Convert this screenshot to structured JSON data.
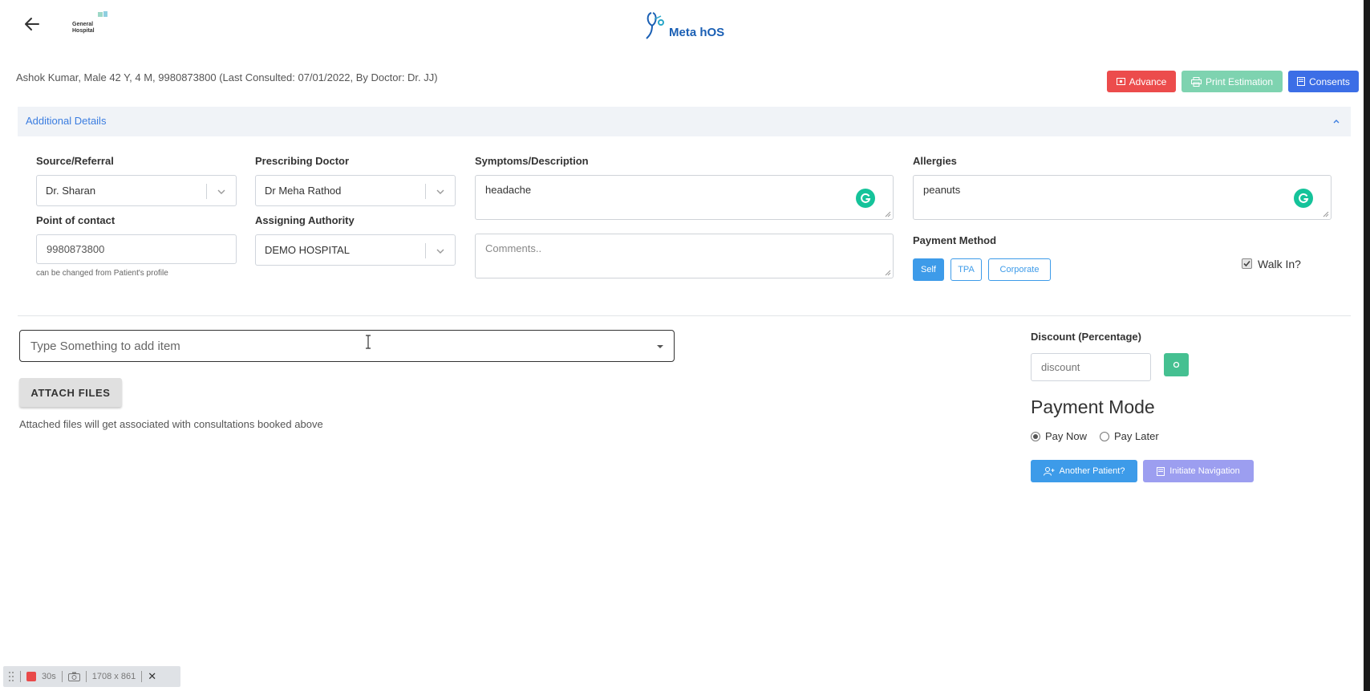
{
  "header": {
    "logo_left_text": "General Hospital",
    "brand": "Meta hOS"
  },
  "patient": {
    "info": "Ashok Kumar, Male 42 Y, 4 M, 9980873800 (Last Consulted: 07/01/2022, By Doctor: Dr. JJ)"
  },
  "actions": {
    "advance": "Advance",
    "print": "Print Estimation",
    "consents": "Consents"
  },
  "additional": {
    "title": "Additional Details",
    "source_label": "Source/Referral",
    "source_value": "Dr. Sharan",
    "poc_label": "Point of contact",
    "poc_value": "9980873800",
    "poc_hint": "can be changed from Patient's profile",
    "doctor_label": "Prescribing Doctor",
    "doctor_value": "Dr Meha Rathod",
    "authority_label": "Assigning Authority",
    "authority_value": "DEMO HOSPITAL",
    "symptoms_label": "Symptoms/Description",
    "symptoms_value": "headache",
    "comments_placeholder": "Comments..",
    "allergies_label": "Allergies",
    "allergies_value": "peanuts",
    "payment_method_label": "Payment Method",
    "payment_methods": [
      "Self",
      "TPA",
      "Corporate"
    ],
    "walkin_label": "Walk In?"
  },
  "items": {
    "search_placeholder": "Type Something to add item",
    "attach_label": "ATTACH FILES",
    "attach_note": "Attached files will get associated with consultations booked above"
  },
  "payment": {
    "discount_label": "Discount (Percentage)",
    "discount_placeholder": "discount",
    "mode_title": "Payment Mode",
    "pay_now": "Pay Now",
    "pay_later": "Pay Later",
    "another_patient": "Another Patient?",
    "initiate_navigation": "Initiate Navigation"
  },
  "recorder": {
    "time": "30s",
    "size": "1708 x 861"
  },
  "colors": {
    "advance": "#ec4c4c",
    "print": "#7ed3b0",
    "consents": "#3c6ee6",
    "accent": "#3d9be9"
  }
}
